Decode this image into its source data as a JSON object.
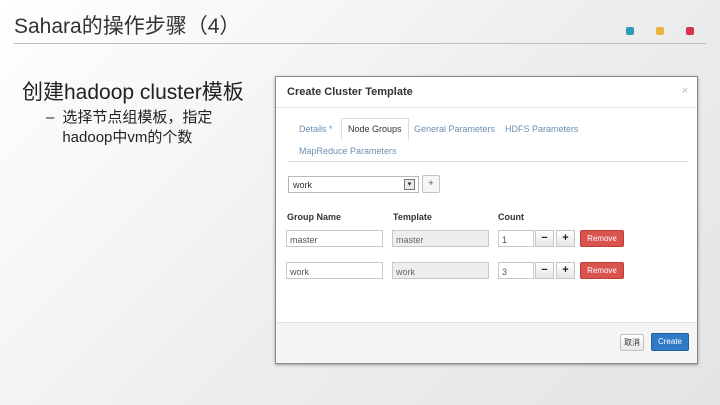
{
  "slide": {
    "title": "Sahara的操作步骤（4）",
    "bullet_main": "创建hadoop cluster模板",
    "bullet_sub_dash": "–",
    "bullet_sub": "选择节点组模板，指定hadoop中vm的个数",
    "dot_colors": [
      "#2a9db5",
      "#e8b43a",
      "#d6334a"
    ]
  },
  "dialog": {
    "title": "Create Cluster Template",
    "close_glyph": "×",
    "tabs": [
      "Details *",
      "Node Groups",
      "General Parameters",
      "HDFS Parameters",
      "MapReduce Parameters"
    ],
    "active_tab": "Node Groups",
    "template_select": {
      "value": "work",
      "arrow": "▾"
    },
    "add_glyph": "+",
    "columns": {
      "group_name": "Group Name",
      "template": "Template",
      "count": "Count"
    },
    "rows": [
      {
        "group_name": "master",
        "template": "master",
        "count": "1"
      },
      {
        "group_name": "work",
        "template": "work",
        "count": "3"
      }
    ],
    "minus_glyph": "−",
    "plus_glyph": "+",
    "remove_label": "Remove",
    "cancel_label": "取消",
    "create_label": "Create",
    "colors": {
      "primary": "#2f7ac7",
      "danger": "#d9534f",
      "link": "#6a8fb0"
    }
  }
}
